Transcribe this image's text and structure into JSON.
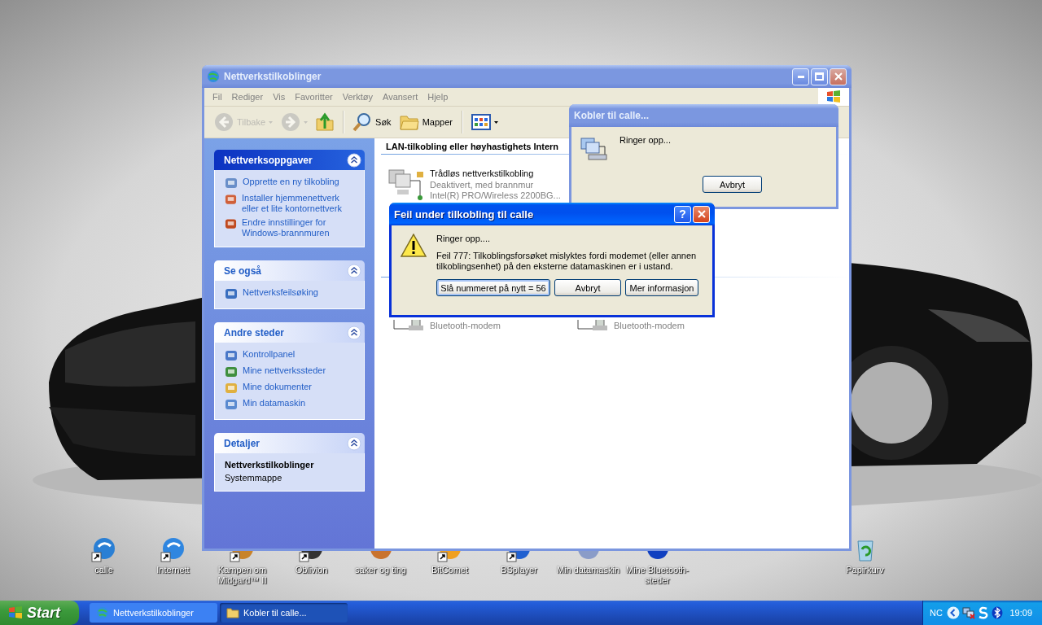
{
  "desktop": {
    "icons": [
      {
        "label": "calle",
        "shortcut": true
      },
      {
        "label": "Internett",
        "shortcut": true
      },
      {
        "label": "Kampen om Midgard™ II",
        "shortcut": true
      },
      {
        "label": "Oblivion",
        "shortcut": true
      },
      {
        "label": "saker og ting",
        "shortcut": false
      },
      {
        "label": "BitComet",
        "shortcut": true
      },
      {
        "label": "BSplayer",
        "shortcut": true
      },
      {
        "label": "Min datamaskin",
        "shortcut": false
      },
      {
        "label": "Mine Bluetooth-steder",
        "shortcut": false
      }
    ],
    "recycle_bin": {
      "label": "Papirkurv"
    }
  },
  "window": {
    "title": "Nettverkstilkoblinger",
    "active": false,
    "menu": [
      "Fil",
      "Rediger",
      "Vis",
      "Favoritter",
      "Verktøy",
      "Avansert",
      "Hjelp"
    ],
    "toolbar": [
      {
        "kind": "back",
        "label": "Tilbake",
        "disabled": true
      },
      {
        "kind": "forward",
        "disabled": true
      },
      {
        "kind": "up",
        "disabled": false
      },
      {
        "kind": "search",
        "label": "Søk",
        "disabled": false
      },
      {
        "kind": "folders",
        "label": "Mapper",
        "disabled": false
      },
      {
        "kind": "views",
        "disabled": false
      }
    ],
    "task_panes": [
      {
        "title": "Nettverksoppgaver",
        "special": true,
        "items": [
          "Opprette en ny tilkobling",
          "Installer hjemmenettverk eller et lite kontornettverk",
          "Endre innstillinger for Windows-brannmuren"
        ]
      },
      {
        "title": "Se også",
        "special": false,
        "items": [
          "Nettverksfeilsøking"
        ]
      },
      {
        "title": "Andre steder",
        "special": false,
        "items": [
          "Kontrollpanel",
          "Mine nettverkssteder",
          "Mine dokumenter",
          "Min datamaskin"
        ]
      },
      {
        "title": "Detaljer",
        "special": false,
        "details": {
          "name": "Nettverkstilkoblinger",
          "type": "Systemmappe"
        }
      }
    ],
    "content": {
      "group_header": "LAN-tilkobling eller høyhastighets Intern",
      "connections": [
        {
          "name": "Trådløs nettverkstilkobling",
          "lines": [
            "Deaktivert, med brannmur",
            "Intel(R) PRO/Wireless 2200BG..."
          ]
        }
      ],
      "modems": [
        {
          "status": "Bluetooth-modem"
        },
        {
          "status": "Bluetooth-modem"
        }
      ]
    }
  },
  "connecting_dialog": {
    "title": "Kobler til calle...",
    "active": false,
    "status": "Ringer opp...",
    "buttons": [
      "Avbryt"
    ]
  },
  "error_dialog": {
    "title": "Feil under tilkobling til calle",
    "active": true,
    "help": "?",
    "status": "Ringer opp....",
    "message": "Feil 777: Tilkoblingsforsøket mislyktes fordi modemet (eller annen tilkoblingsenhet) på den eksterne datamaskinen er i ustand.",
    "buttons": [
      {
        "label": "Slå nummeret på nytt = 56",
        "default": true
      },
      {
        "label": "Avbryt",
        "default": false
      },
      {
        "label": "Mer informasjon",
        "default": false
      }
    ]
  },
  "taskbar": {
    "start": "Start",
    "tasks": [
      {
        "label": "Nettverkstilkoblinger",
        "selected": false
      },
      {
        "label": "Kobler til calle...",
        "selected": true
      }
    ],
    "tray": {
      "language": "NC",
      "time": "19:09"
    }
  }
}
